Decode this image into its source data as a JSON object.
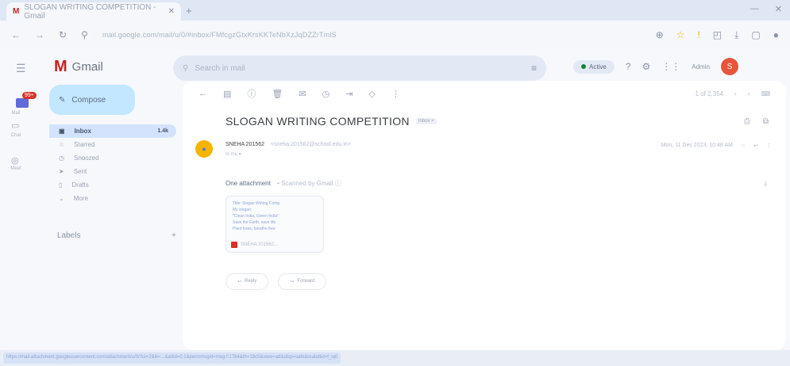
{
  "browser": {
    "tab_title": "SLOGAN WRITING COMPETITION - Gmail",
    "tab_icon": "gmail-icon",
    "new_tab": "+",
    "url": "mail.google.com/mail/u/0/#inbox/FMfcgzGtxKrsKKTeNbXzJqDZZrTmlS"
  },
  "gmail": {
    "logo_letter": "M",
    "logo_text": "Gmail",
    "search_placeholder": "Search in mail",
    "status": "Active",
    "account_label": "Admin",
    "avatar_letter": "S",
    "mail_badge": "99+",
    "rail": {
      "mail": "Mail",
      "chat": "Chat",
      "meet": "Meet"
    },
    "compose": "Compose",
    "nav": [
      {
        "label": "Inbox",
        "count": "1.4k",
        "selected": true
      },
      {
        "label": "Starred"
      },
      {
        "label": "Snoozed"
      },
      {
        "label": "Sent"
      },
      {
        "label": "Drafts"
      },
      {
        "label": "More"
      }
    ],
    "labels_heading": "Labels",
    "pager": "1 of 2,354"
  },
  "message": {
    "subject": "SLOGAN WRITING COMPETITION",
    "label_chip": "Inbox ×",
    "sender_name": "SNEHA 201562",
    "sender_email": "<sneha.201562@school.edu.in>",
    "to": "to me ▾",
    "date": "Mon, 11 Dec 2023, 10:48 AM",
    "attachment_header": "One attachment",
    "scan_note": "• Scanned by Gmail ⓘ",
    "thumb_lines": [
      "Title: Slogan Writing Comp.",
      "  My slogan:",
      "  \"Clean India, Green India\"",
      "  Save the Earth, save life",
      "  Plant trees, breathe free"
    ],
    "attachment_name": "SNEHA 201562...",
    "reply": "Reply",
    "forward": "Forward"
  },
  "status_url": "https://mail-attachment.googleusercontent.com/attachment/u/0/?ui=2&ik=...&attid=0.1&permmsgid=msg-f:1784&th=18c5&view=att&disp=safe&realattid=f_lq0"
}
